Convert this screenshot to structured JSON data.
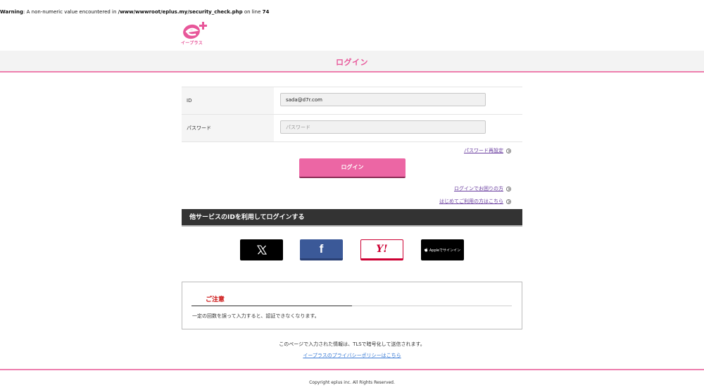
{
  "warning": {
    "label": "Warning",
    "text_before": ": A non-numeric value encountered in ",
    "path": "/www/wwwroot/eplus.my/security_check.php",
    "text_mid": " on line ",
    "line": "74"
  },
  "brand": {
    "logo_icon": "eplus-logo-icon",
    "logo_text": "イープラス",
    "color": "#e8579a"
  },
  "page": {
    "title": "ログイン"
  },
  "form": {
    "id_label": "ID",
    "id_value": "sada@d7r.com",
    "password_label": "パスワード",
    "password_placeholder": "パスワード"
  },
  "links": {
    "password_reset": "パスワード再設定",
    "login_help": "ログインでお困りの方",
    "first_time": "はじめてご利用の方はこちら",
    "privacy": "イープラスのプライバシーポリシーはこちら"
  },
  "login_button": "ログイン",
  "sns": {
    "header": "他サービスのIDを利用してログインする",
    "x_icon": "x-logo-icon",
    "facebook_icon": "facebook-logo-icon",
    "facebook_mark": "f",
    "yahoo_icon": "yahoo-logo-icon",
    "yahoo_mark": "Y!",
    "apple_label": "Appleでサインイン"
  },
  "notice": {
    "title": "ご注意",
    "text": "一定の回数を誤って入力すると、認証できなくなります。"
  },
  "secure_text": "このページで入力された情報は、TLSで暗号化して送信されます。",
  "footer": {
    "copyright": "Copyright eplus inc. All Rights Reserved."
  },
  "colors": {
    "accent": "#e8579a",
    "button": "#ec66a4",
    "sns_header_bg": "#333333",
    "notice_title": "#cc1111"
  }
}
